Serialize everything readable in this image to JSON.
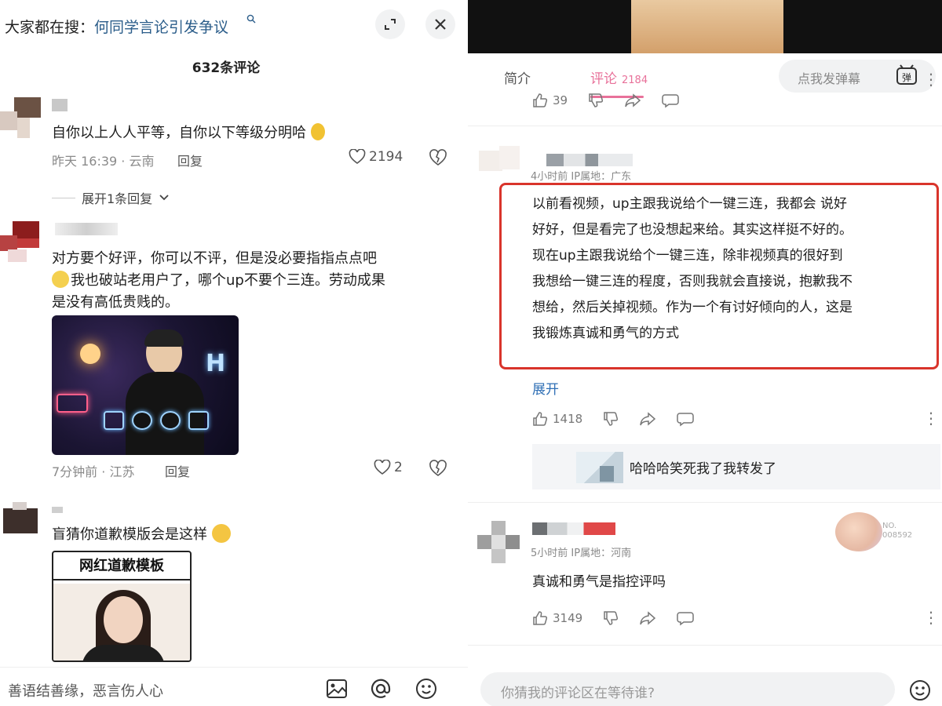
{
  "left": {
    "search_prefix": "大家都在搜：",
    "search_query": "何同学言论引发争议",
    "comment_count": "632条评论",
    "comments": [
      {
        "text": "自你以上人人平等，自你以下等级分明哈",
        "meta": "昨天 16:39 · 云南",
        "reply": "回复",
        "likes": "2194",
        "expand": "展开1条回复"
      },
      {
        "text_line1": "对方要个好评，你可以不评，但是没必要指指点点吧",
        "text_line2": "我也破站老用户了，哪个up不要个三连。劳动成果",
        "text_line3": "是没有高低贵贱的。",
        "meta": "7分钟前 · 江苏",
        "reply": "回复",
        "likes": "2"
      },
      {
        "text": "盲猜你道歉模版会是这样",
        "image_title": "网红道歉模板"
      }
    ],
    "bottom_placeholder": "善语结善缘，恶言伤人心"
  },
  "right": {
    "tabs": [
      {
        "label": "简介"
      },
      {
        "label": "评论",
        "count": "2184"
      }
    ],
    "danmaku_placeholder": "点我发弹幕",
    "danmaku_icon_text": "弹",
    "prev_likes": "39",
    "comment1": {
      "meta": "4小时前  IP属地：广东",
      "lines": [
        "以前看视频，up主跟我说给个一键三连，我都会 说好",
        "好好，但是看完了也没想起来给。其实这样挺不好的。",
        "现在up主跟我说给个一键三连，除非视频真的很好到",
        "我想给一键三连的程度，否则我就会直接说，抱歉我不",
        "想给，然后关掉视频。作为一个有讨好倾向的人，这是",
        "我锻炼真诚和勇气的方式"
      ],
      "expand": "展开",
      "likes": "1418",
      "sub_reply": "哈哈哈笑死我了我转发了"
    },
    "comment2": {
      "meta": "5小时前  IP属地：河南",
      "text": "真诚和勇气是指控评吗",
      "likes": "3149",
      "badge_no": "NO.",
      "badge_num": "008592"
    },
    "bottom_placeholder": "你猜我的评论区在等待谁?"
  }
}
